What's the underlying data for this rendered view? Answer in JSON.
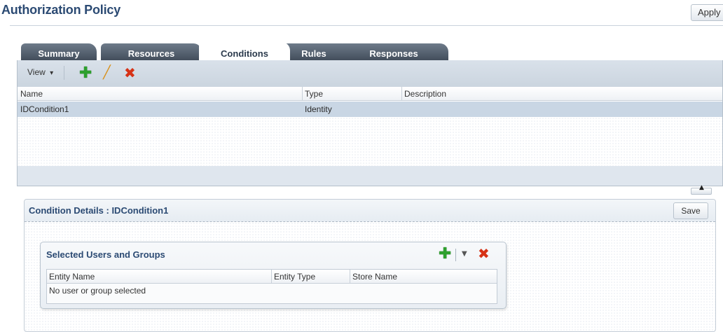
{
  "header": {
    "title": "Authorization Policy",
    "apply_label": "Apply"
  },
  "tabs": [
    {
      "label": "Summary",
      "active": false
    },
    {
      "label": "Resources",
      "active": false
    },
    {
      "label": "Conditions",
      "active": true
    },
    {
      "label": "Rules",
      "active": false
    },
    {
      "label": "Responses",
      "active": false
    }
  ],
  "conditions": {
    "toolbar": {
      "view_label": "View",
      "view_caret": "▾",
      "icons": [
        "add-icon",
        "edit-icon",
        "delete-icon"
      ]
    },
    "columns": [
      "Name",
      "Type",
      "Description"
    ],
    "rows": [
      {
        "name": "IDCondition1",
        "type": "Identity",
        "description": ""
      }
    ],
    "selected_row_color": "#c9d6e4"
  },
  "splitter": {
    "glyph": "▲"
  },
  "details": {
    "title": "Condition Details : IDCondition1",
    "save_label": "Save",
    "users_groups": {
      "title": "Selected Users and Groups",
      "icons": [
        "add-icon",
        "dropdown-icon",
        "delete-icon"
      ],
      "columns": [
        "Entity Name",
        "Entity Type",
        "Store Name"
      ],
      "empty_text": "No user or group selected"
    }
  },
  "colors": {
    "title_blue": "#2b4a73",
    "tab_dark": "#4a5563",
    "add_green": "#2ea02e",
    "delete_red": "#d63216"
  }
}
